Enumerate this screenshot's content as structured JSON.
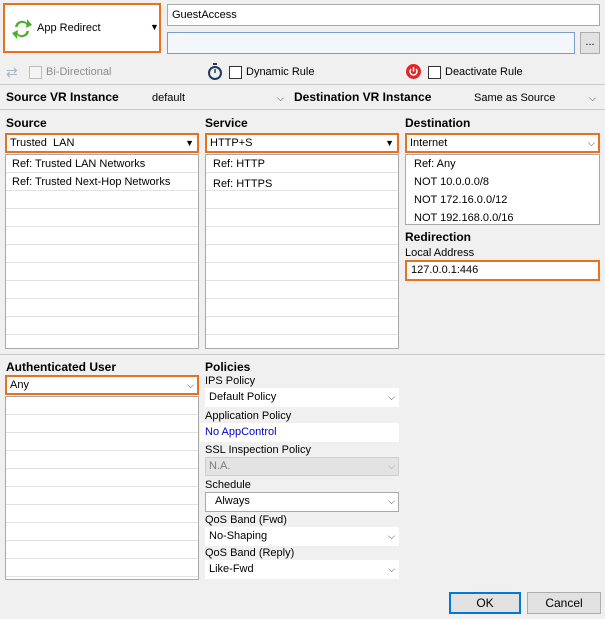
{
  "action": {
    "label": "App Redirect",
    "icon": "redirect-arrows-icon"
  },
  "rule_name": "GuestAccess",
  "rule_description": "",
  "more_button": "...",
  "options": {
    "bidirectional": "Bi-Directional",
    "dynamic_rule": "Dynamic Rule",
    "deactivate_rule": "Deactivate Rule"
  },
  "vr": {
    "source_label": "Source VR Instance",
    "source_value": "default",
    "dest_label": "Destination VR Instance",
    "dest_value": "Same as Source"
  },
  "source": {
    "heading": "Source",
    "selected": "Trusted  LAN",
    "items": [
      "Ref: Trusted LAN Networks",
      "Ref: Trusted Next-Hop Networks"
    ]
  },
  "service": {
    "heading": "Service",
    "selected": "HTTP+S",
    "items": [
      "Ref: HTTP",
      "Ref: HTTPS"
    ]
  },
  "destination": {
    "heading": "Destination",
    "selected": "Internet",
    "items": [
      "Ref: Any",
      "NOT 10.0.0.0/8",
      "NOT 172.16.0.0/12",
      "NOT 192.168.0.0/16"
    ]
  },
  "redirection": {
    "heading": "Redirection",
    "local_address_label": "Local Address",
    "local_address_value": "127.0.0.1:446"
  },
  "auth_user": {
    "heading": "Authenticated User",
    "selected": "Any"
  },
  "policies": {
    "heading": "Policies",
    "ips_label": "IPS Policy",
    "ips_value": "Default Policy",
    "app_label": "Application Policy",
    "app_value": "No AppControl",
    "ssl_label": "SSL Inspection Policy",
    "ssl_value": "N.A.",
    "schedule_label": "Schedule",
    "schedule_value": "Always",
    "qos_fwd_label": "QoS Band (Fwd)",
    "qos_fwd_value": "No-Shaping",
    "qos_reply_label": "QoS Band (Reply)",
    "qos_reply_value": "Like-Fwd"
  },
  "buttons": {
    "ok": "OK",
    "cancel": "Cancel"
  },
  "colors": {
    "highlight": "#e8701e",
    "link": "#0000cc",
    "deactivate": "#e0262b",
    "redirect_icon": "#4caf2a"
  }
}
